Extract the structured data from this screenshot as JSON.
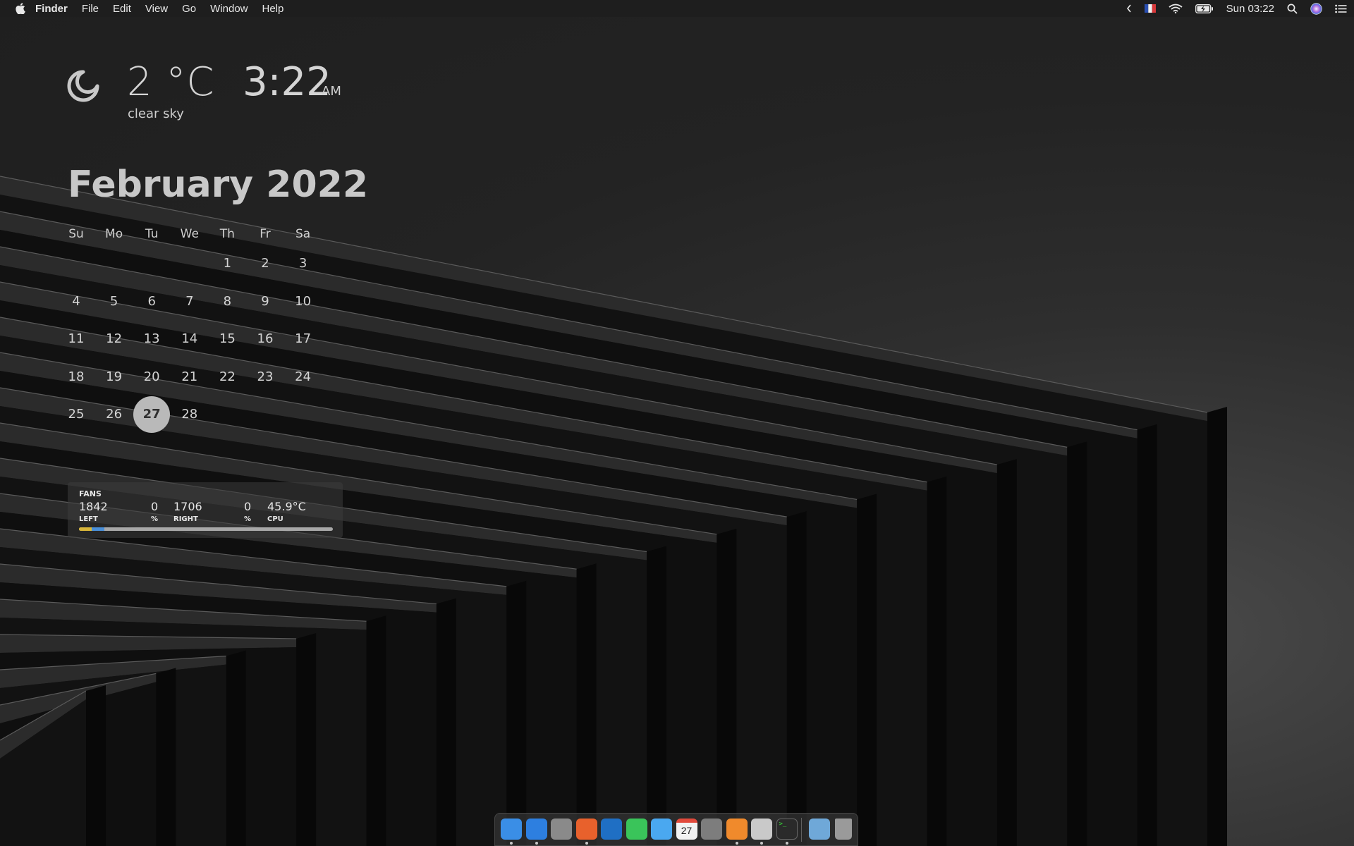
{
  "menubar": {
    "app_name": "Finder",
    "items": [
      "File",
      "Edit",
      "View",
      "Go",
      "Window",
      "Help"
    ],
    "clock": "Sun 03:22"
  },
  "weather": {
    "temperature": "2 °C",
    "description": "clear sky",
    "icon": "moon-icon"
  },
  "clock": {
    "time": "3:22",
    "ampm": "AM"
  },
  "calendar": {
    "title": "February 2022",
    "weekdays": [
      "Su",
      "Mo",
      "Tu",
      "We",
      "Th",
      "Fr",
      "Sa"
    ],
    "first_weekday_index": 2,
    "days_in_month": 28,
    "today": 27
  },
  "fans": {
    "title": "FANS",
    "left_rpm": "1842",
    "left_percent": "0",
    "left_label": "LEFT",
    "percent_unit": "%",
    "right_rpm": "1706",
    "right_percent": "0",
    "right_label": "RIGHT",
    "cpu_temp": "45.9°C",
    "cpu_label": "CPU"
  },
  "dock": {
    "apps": [
      {
        "name": "finder",
        "color": "#3a8ee6",
        "running": true
      },
      {
        "name": "safari",
        "color": "#2d7fe0",
        "running": true
      },
      {
        "name": "launchpad",
        "color": "#8a8a8a",
        "running": false
      },
      {
        "name": "firefox",
        "color": "#e8612c",
        "running": true
      },
      {
        "name": "outlook",
        "color": "#1f6fc4",
        "running": false
      },
      {
        "name": "facetime",
        "color": "#3ac45a",
        "running": false
      },
      {
        "name": "messages",
        "color": "#4aa8f0",
        "running": false
      },
      {
        "name": "calendar",
        "color": "#f2f2f2",
        "running": false,
        "label": "27"
      },
      {
        "name": "system-preferences",
        "color": "#7d7d7d",
        "running": false
      },
      {
        "name": "sublime-text",
        "color": "#f08a2c",
        "running": true
      },
      {
        "name": "preview",
        "color": "#c9c9c9",
        "running": true
      },
      {
        "name": "terminal",
        "color": "#2a2a2a",
        "running": true
      }
    ],
    "extras": [
      {
        "name": "downloads-folder",
        "color": "#6fa8d8"
      },
      {
        "name": "trash",
        "color": "#9a9a9a"
      }
    ]
  }
}
